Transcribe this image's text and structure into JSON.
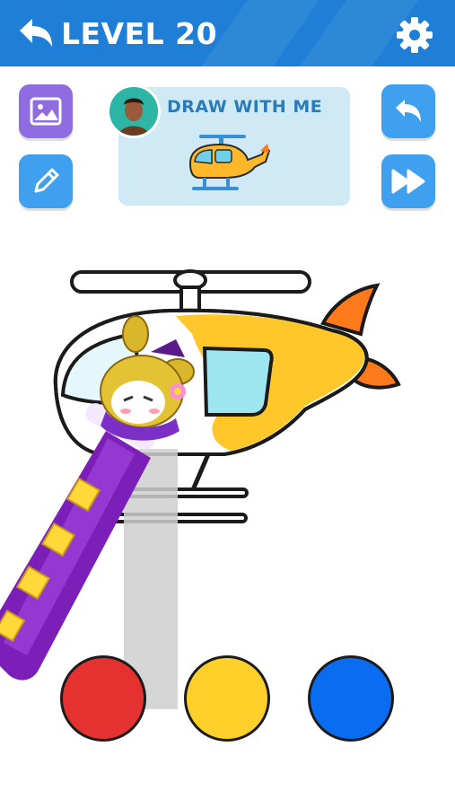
{
  "header": {
    "level_title": "LEVEL 20",
    "background_color": "#1f7fd6",
    "back_icon": "back-arrow-icon",
    "settings_icon": "gear-icon"
  },
  "tools": {
    "image_button_icon": "image-icon",
    "image_button_color": "#8f6ce0",
    "pencil_button_icon": "pencil-icon",
    "pencil_button_color": "#3fa0ef",
    "undo_button_icon": "undo-icon",
    "undo_button_color": "#3fa0ef",
    "skip_button_icon": "fast-forward-icon",
    "skip_button_color": "#3fa0ef"
  },
  "reference": {
    "label": "DRAW WITH ME",
    "subject": "helicopter"
  },
  "palette": {
    "colors": [
      "#e5312f",
      "#ffd02a",
      "#0a6cf0"
    ]
  }
}
